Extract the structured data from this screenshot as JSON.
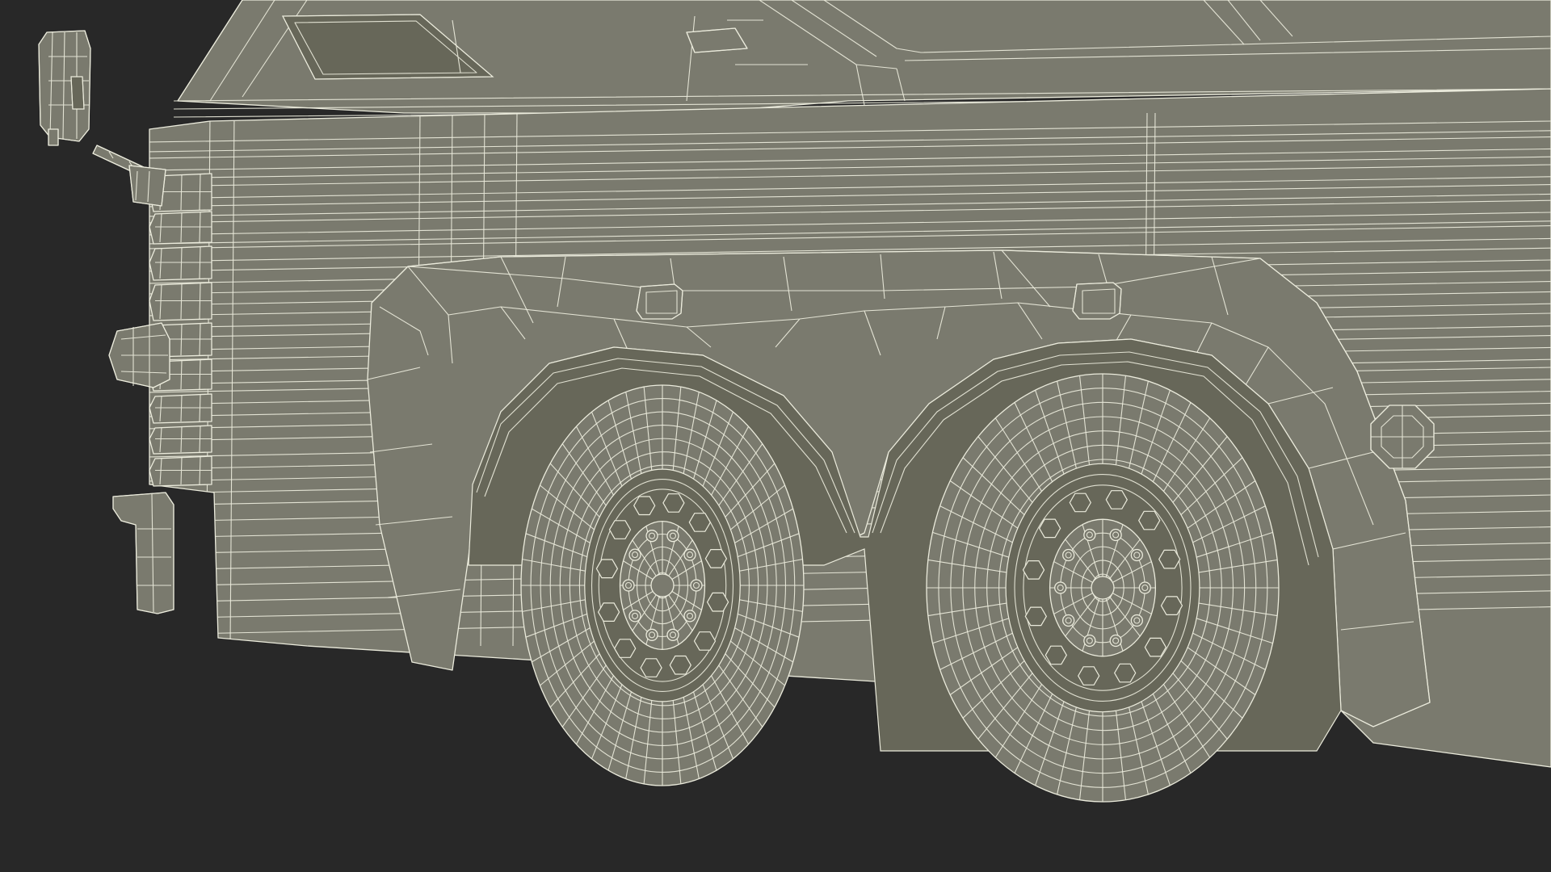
{
  "scene": {
    "subject": "armored-truck-wireframe-render",
    "background_color": "#282828",
    "body_color": "#7a7a6e",
    "body_shadow_color": "#676759",
    "wire_color": "#ebebdc"
  }
}
